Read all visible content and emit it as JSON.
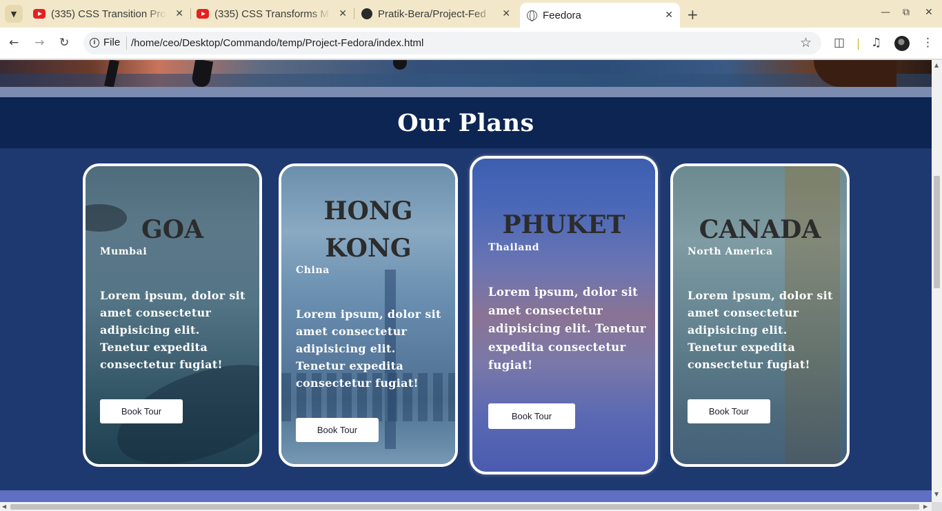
{
  "browser": {
    "tabs": [
      {
        "title": "(335) CSS Transition Pro",
        "icon": "youtube-icon",
        "active": false
      },
      {
        "title": "(335) CSS Transforms M",
        "icon": "youtube-icon",
        "active": false
      },
      {
        "title": "Pratik-Bera/Project-Fed",
        "icon": "github-icon",
        "active": false
      },
      {
        "title": "Feedora",
        "icon": "globe-icon",
        "active": true
      }
    ],
    "address": {
      "scheme_label": "File",
      "url": "/home/ceo/Desktop/Commando/temp/Project-Fedora/index.html"
    }
  },
  "page": {
    "section_title": "Our Plans",
    "cards": [
      {
        "city": "GOA",
        "country": "Mumbai",
        "description": "Lorem ipsum, dolor sit amet consectetur adipisicing elit. Tenetur expedita consectetur fugiat!",
        "button": "Book Tour"
      },
      {
        "city": "HONG KONG",
        "country": "China",
        "description": "Lorem ipsum, dolor sit amet consectetur adipisicing elit. Tenetur expedita consectetur fugiat!",
        "button": "Book Tour"
      },
      {
        "city": "PHUKET",
        "country": "Thailand",
        "description": "Lorem ipsum, dolor sit amet consectetur adipisicing elit. Tenetur expedita consectetur fugiat!",
        "button": "Book Tour"
      },
      {
        "city": "CANADA",
        "country": "North America",
        "description": "Lorem ipsum, dolor sit amet consectetur adipisicing elit. Tenetur expedita consectetur fugiat!",
        "button": "Book Tour"
      }
    ]
  },
  "colors": {
    "tabbar": "#f2e8c9",
    "page_bg": "#1e3870",
    "header_bg": "#0c2552",
    "card_border": "#ffffff"
  }
}
